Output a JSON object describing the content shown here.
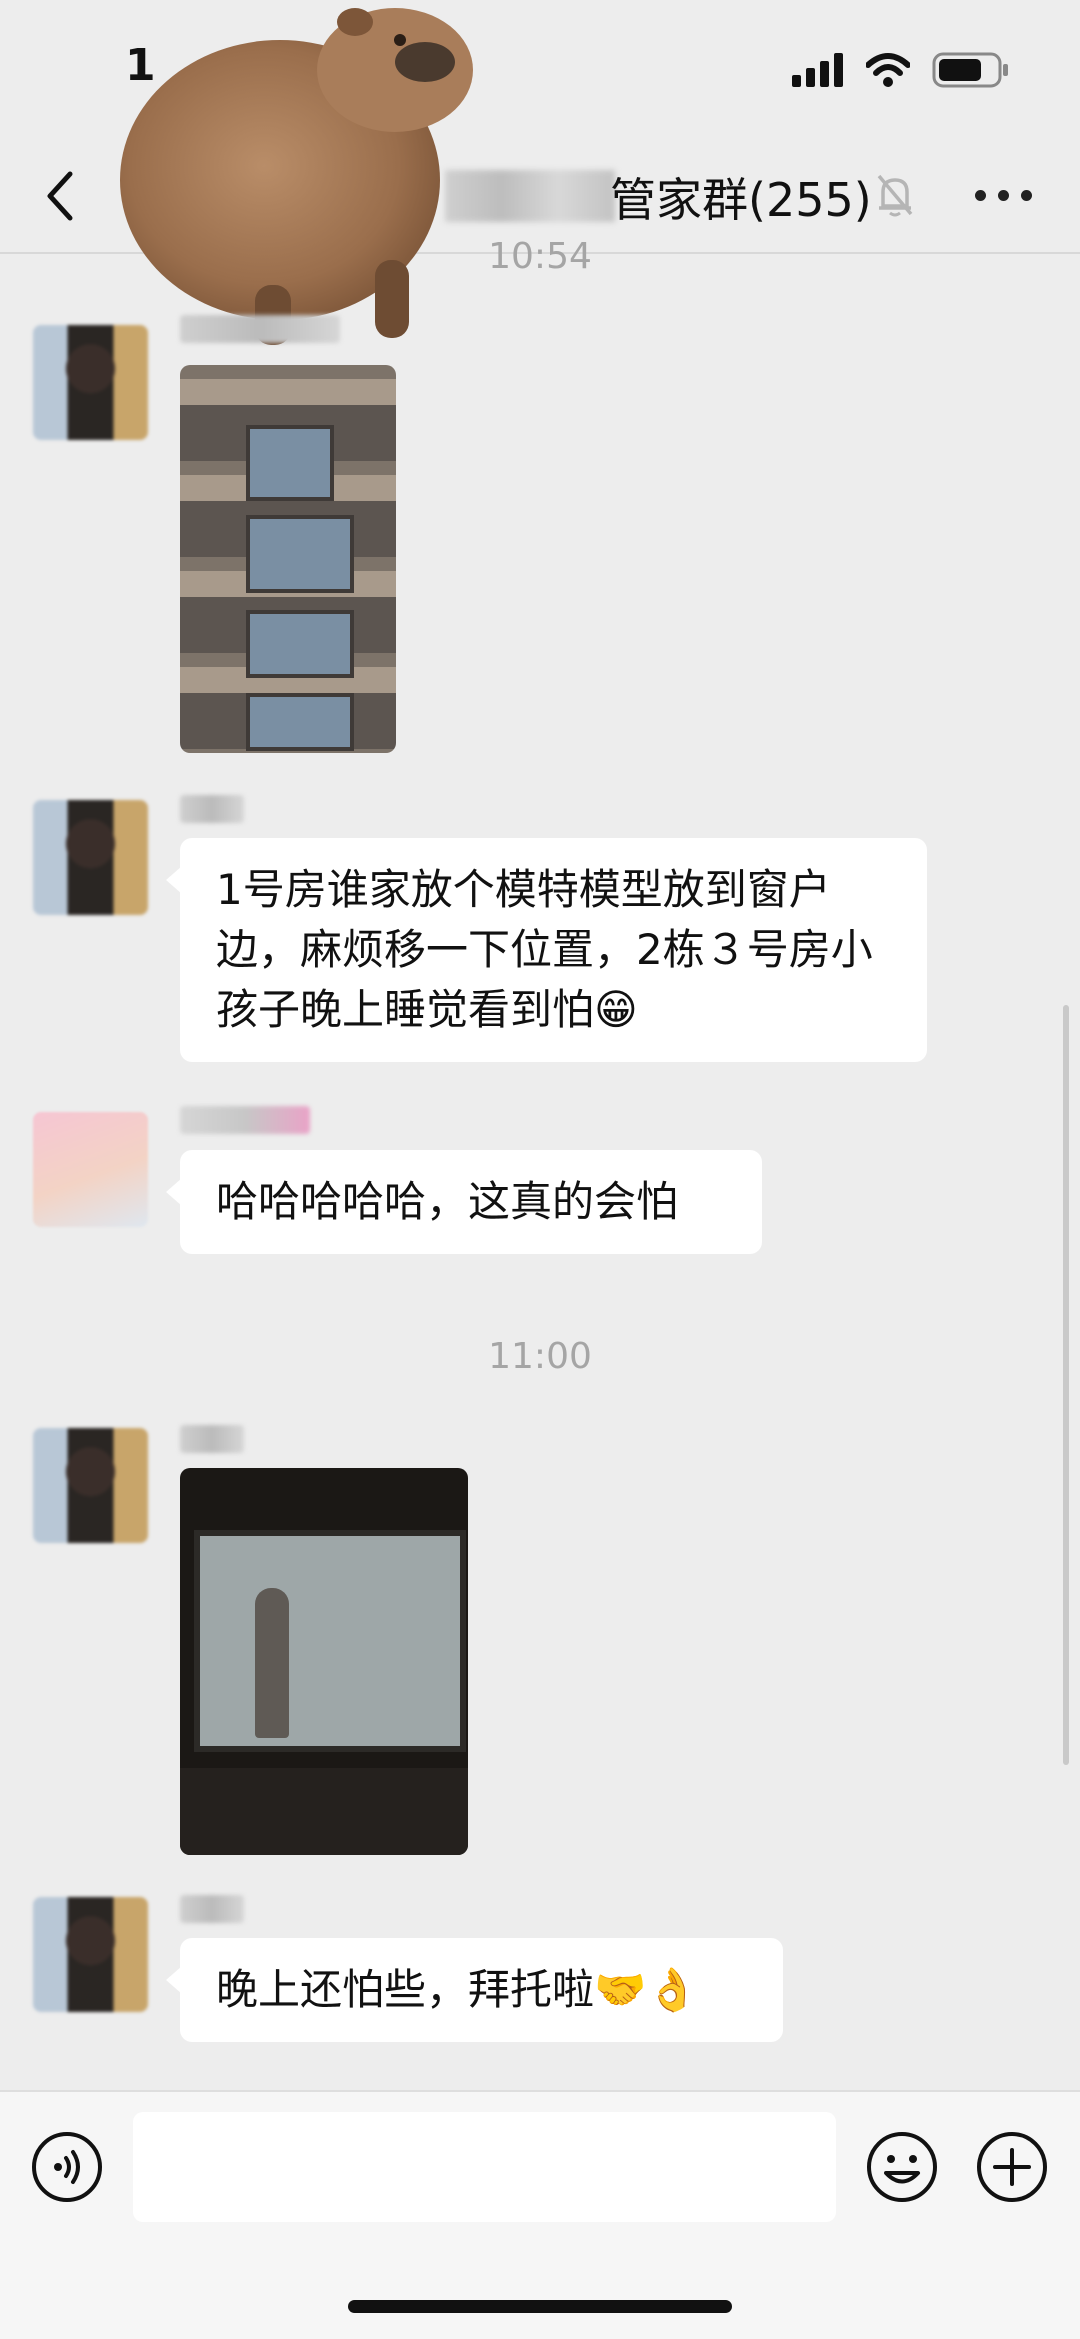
{
  "status_bar": {
    "time": "1"
  },
  "header": {
    "title": "管家群(255)",
    "back_icon": "chevron-left-icon",
    "mute_icon": "bell-muted-icon",
    "more_icon": "more-dots-icon"
  },
  "messages": [
    {
      "type": "time",
      "text": "10:54"
    },
    {
      "type": "image",
      "sender": "",
      "description_icon": "building-photo"
    },
    {
      "type": "text",
      "sender": "",
      "text": "1号房谁家放个模特模型放到窗户边，麻烦移一下位置，2栋３号房小孩子晚上睡觉看到怕😁"
    },
    {
      "type": "text",
      "sender": "",
      "text": "哈哈哈哈哈，这真的会怕"
    },
    {
      "type": "time",
      "text": "11:00"
    },
    {
      "type": "image",
      "sender": "",
      "description_icon": "night-window-photo"
    },
    {
      "type": "text",
      "sender": "",
      "text": "晚上还怕些，拜托啦🤝👌"
    }
  ],
  "input_bar": {
    "voice_icon": "voice-icon",
    "emoji_icon": "emoji-icon",
    "plus_icon": "plus-icon",
    "input_value": ""
  },
  "colors": {
    "background": "#ededed",
    "bubble": "#ffffff",
    "timestamp": "#a5a5a5"
  }
}
